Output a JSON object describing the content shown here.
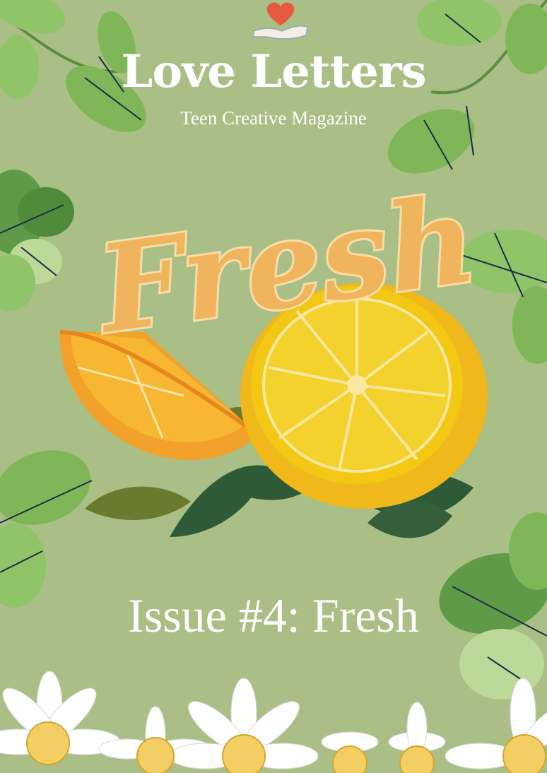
{
  "cover": {
    "title": "Love Letters",
    "subtitle": "Teen Creative Magazine",
    "illustration_word": "Fresh",
    "issue_label": "Issue #4: Fresh"
  },
  "icons": {
    "logo": "heart-in-hand-icon"
  },
  "colors": {
    "background": "#a9bf85",
    "text": "#ffffff",
    "orange": "#f2a12a",
    "lemon": "#f2c814",
    "leaf_dark": "#2f5a37",
    "leaf_light": "#8fc468",
    "heart": "#e85a3f"
  }
}
